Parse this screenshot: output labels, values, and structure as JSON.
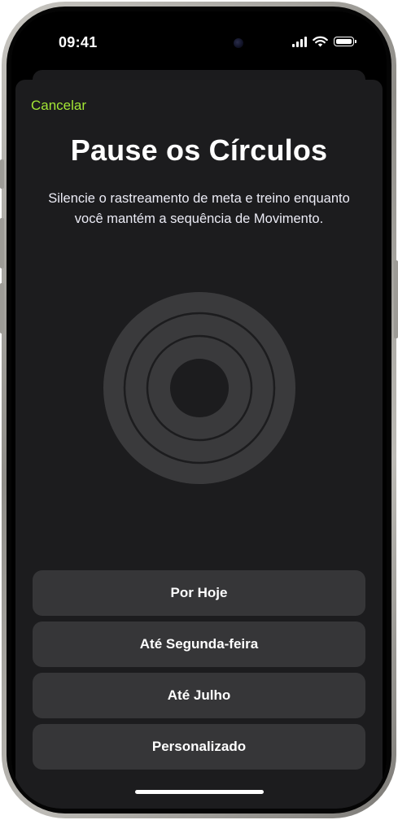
{
  "status_bar": {
    "time": "09:41",
    "icons": [
      "cellular-signal-icon",
      "wifi-icon",
      "battery-icon"
    ]
  },
  "sheet": {
    "cancel_label": "Cancelar",
    "title": "Pause os Círculos",
    "description": "Silencie o rastreamento de meta e treino enquanto você mantém a sequência de Movimento.",
    "options": [
      {
        "label": "Por Hoje"
      },
      {
        "label": "Até Segunda-feira"
      },
      {
        "label": "Até Julho"
      },
      {
        "label": "Personalizado"
      }
    ]
  },
  "colors": {
    "accent": "#a3e635",
    "sheet_background": "#1c1c1e",
    "button_background": "#363638",
    "rings": "#3a3a3c"
  }
}
